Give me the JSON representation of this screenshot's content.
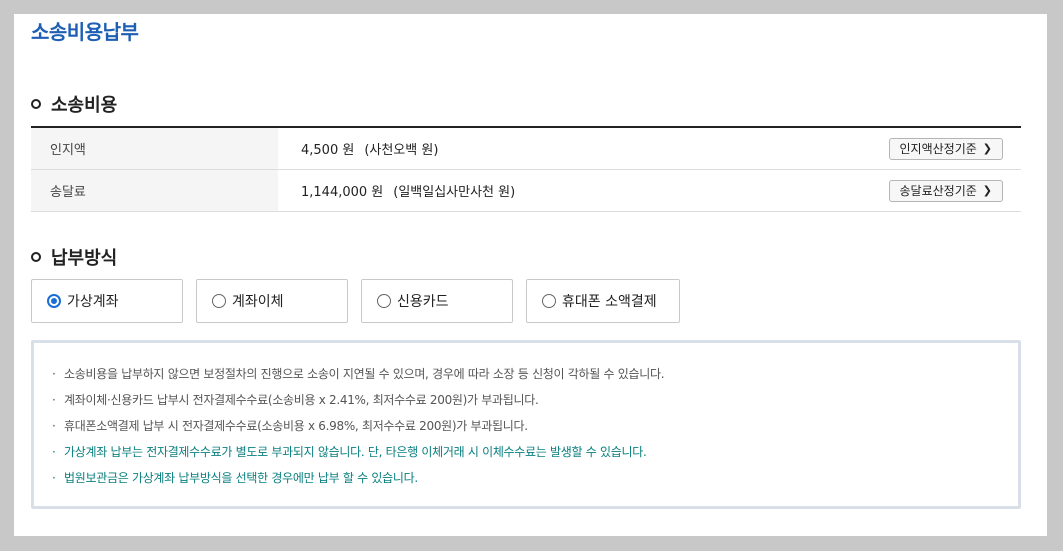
{
  "page": {
    "title": "소송비용납부"
  },
  "cost_section": {
    "heading": "소송비용",
    "rows": [
      {
        "label": "인지액",
        "amount": "4,500 원",
        "amount_korean": "(사천오백 원)",
        "button": "인지액산정기준"
      },
      {
        "label": "송달료",
        "amount": "1,144,000 원",
        "amount_korean": "(일백일십사만사천 원)",
        "button": "송달료산정기준"
      }
    ]
  },
  "payment_section": {
    "heading": "납부방식",
    "options": [
      {
        "label": "가상계좌",
        "checked": true
      },
      {
        "label": "계좌이체",
        "checked": false
      },
      {
        "label": "신용카드",
        "checked": false
      },
      {
        "label": "휴대폰 소액결제",
        "checked": false
      }
    ]
  },
  "notices": [
    {
      "text": "소송비용을 납부하지 않으면 보정절차의 진행으로 소송이 지연될 수 있으며, 경우에 따라 소장 등 신청이 각하될 수 있습니다.",
      "highlight": false
    },
    {
      "text": "계좌이체·신용카드 납부시 전자결제수수료(소송비용 x 2.41%, 최저수수료 200원)가 부과됩니다.",
      "highlight": false
    },
    {
      "text": "휴대폰소액결제 납부 시 전자결제수수료(소송비용 x 6.98%, 최저수수료 200원)가 부과됩니다.",
      "highlight": false
    },
    {
      "text": "가상계좌 납부는 전자결제수수료가 별도로 부과되지 않습니다. 단, 타은행 이체거래 시 이체수수료는 발생할 수 있습니다.",
      "highlight": true
    },
    {
      "text": "법원보관금은 가상계좌 납부방식을 선택한 경우에만 납부 할 수 있습니다.",
      "highlight": true
    }
  ],
  "colors": {
    "title": "#1e5fb4",
    "highlight": "#0a7f7f",
    "radio_checked": "#1a6fd6"
  }
}
